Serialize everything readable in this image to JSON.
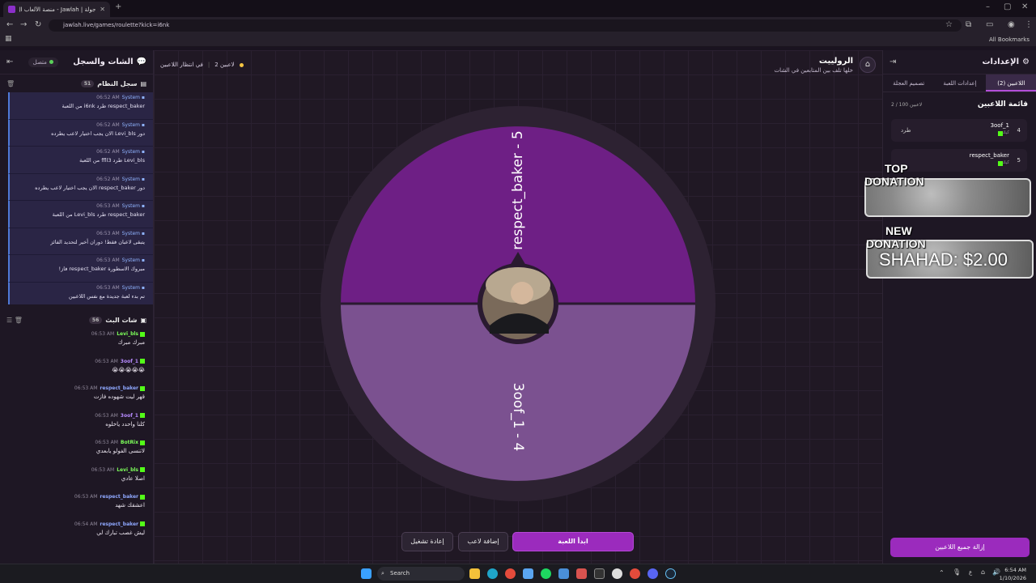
{
  "browser": {
    "tab_title": "جولة | Jawlah - منصة الألعاب ال...",
    "url": "jawlah.live/games/roulette?kick=i6nk",
    "bookmarks": "All Bookmarks"
  },
  "left_panel": {
    "title": "الشات والسجل",
    "status": "متصل",
    "system_log": {
      "title": "سجل النظام",
      "count": "51",
      "items": [
        {
          "user": "System",
          "time": "06:52 AM",
          "msg": "respect_baker طرد i6nk من اللعبة"
        },
        {
          "user": "System",
          "time": "06:52 AM",
          "msg": "دور Levi_bls الان يجب اختيار لاعب يطرده"
        },
        {
          "user": "System",
          "time": "06:52 AM",
          "msg": "Levi_bls طرد ffll3 من اللعبة"
        },
        {
          "user": "System",
          "time": "06:52 AM",
          "msg": "دور respect_baker الان يجب اختيار لاعب يطرده"
        },
        {
          "user": "System",
          "time": "06:53 AM",
          "msg": "respect_baker طرد Levi_bls من اللعبة"
        },
        {
          "user": "System",
          "time": "06:53 AM",
          "msg": "يتبقى لاعبان فقط! دوران أخير لتحديد الفائز"
        },
        {
          "user": "System",
          "time": "06:53 AM",
          "msg": "مبروك الاسطورة respect_baker فاز!"
        },
        {
          "user": "System",
          "time": "06:53 AM",
          "msg": "تم بدء لعبة جديدة مع نفس اللاعبين"
        }
      ]
    },
    "live_chat": {
      "title": "شات البث",
      "count": "56",
      "items": [
        {
          "user": "Levi_bls",
          "time": "06:53 AM",
          "msg": "مبرك مبرك",
          "color": "#7dff5a"
        },
        {
          "user": "3oof_1",
          "time": "06:53 AM",
          "msg": "😭😭😭😭😭",
          "color": "#b78bff"
        },
        {
          "user": "respect_baker",
          "time": "06:53 AM",
          "msg": "قهر ليت شهوده فازت",
          "color": "#8fa8ff"
        },
        {
          "user": "3oof_1",
          "time": "06:53 AM",
          "msg": "كلنا واحدد ياخلوه",
          "color": "#b78bff"
        },
        {
          "user": "BotRix",
          "time": "06:53 AM",
          "msg": "لاتنسى الفولو يابعدي",
          "color": "#7dff5a"
        },
        {
          "user": "Levi_bls",
          "time": "06:53 AM",
          "msg": "اصلا عادي",
          "color": "#7dff5a"
        },
        {
          "user": "respect_baker",
          "time": "06:53 AM",
          "msg": "اعشقك شهد",
          "color": "#8fa8ff"
        },
        {
          "user": "respect_baker",
          "time": "06:54 AM",
          "msg": "ليش غصب تبارك لي",
          "color": "#8fa8ff"
        }
      ]
    }
  },
  "center": {
    "title": "الرولييت",
    "subtitle": "خلها تلف بين المتابعين في الشات",
    "players_count": "2 لاعبين",
    "waiting": "في انتظار اللاعبين",
    "wheel": {
      "segments": [
        {
          "label": "respect_baker - 5",
          "color": "#6e1f85"
        },
        {
          "label": "3oof_1 - 4",
          "color": "#7b5190"
        }
      ]
    },
    "buttons": {
      "start": "ابدأ اللعبة",
      "add_player": "إضافة لاعب",
      "restart": "إعادة تشغيل"
    }
  },
  "right_panel": {
    "title": "الإعدادات",
    "tabs": [
      "اللاعبين (2)",
      "إعدادات اللعبة",
      "تصميم العجلة"
    ],
    "players_list_title": "قائمة اللاعبين",
    "players_count": "2 / 100 لاعبين",
    "players": [
      {
        "num": "4",
        "name": "3oof_1",
        "platform": "كيك",
        "kick_label": "طرد"
      },
      {
        "num": "5",
        "name": "respect_baker",
        "platform": "كيك",
        "kick_label": ""
      }
    ],
    "clear_all": "إزالة جميع اللاعبين"
  },
  "donation_overlay": {
    "top_label_1": "TOP",
    "top_label_2": "DONATION",
    "new_label_1": "NEW",
    "new_label_2": "DONATION",
    "new_text": "SHAHAD: $2.00"
  },
  "taskbar": {
    "search": "Search",
    "time": "6:54 AM",
    "date": "1/10/2026",
    "lang": "ع"
  }
}
